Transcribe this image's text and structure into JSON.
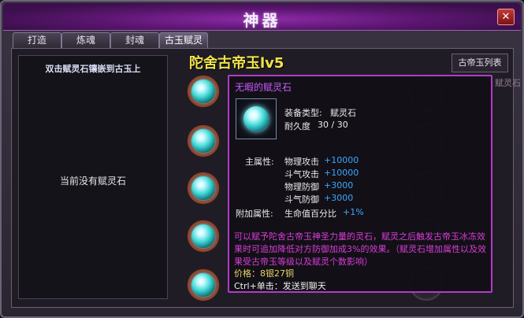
{
  "window": {
    "title": "神器",
    "close": "✕"
  },
  "tabs": [
    "打造",
    "炼魂",
    "封魂",
    "古玉赋灵"
  ],
  "left_panel": {
    "hint": "双击赋灵石镶嵌到古玉上",
    "empty": "当前没有赋灵石"
  },
  "jade": {
    "name": "陀舍古帝玉lv5",
    "list_button": "古帝玉列表"
  },
  "right_slot_label": "赋灵石",
  "tooltip": {
    "name": "无暇的赋灵石",
    "equip_type_label": "装备类型:",
    "equip_type": "赋灵石",
    "durability_label": "耐久度",
    "durability": "30 / 30",
    "main_attr_label": "主属性:",
    "attrs": [
      {
        "name": "物理攻击",
        "value": "+10000"
      },
      {
        "name": "斗气攻击",
        "value": "+10000"
      },
      {
        "name": "物理防御",
        "value": "+3000"
      },
      {
        "name": "斗气防御",
        "value": "+3000"
      }
    ],
    "extra_attr_label": "附加属性:",
    "extra_attr_name": "生命值百分比",
    "extra_attr_value": "+1%",
    "description": "可以赋予陀舍古帝玉神圣力量的灵石，赋灵之后触发古帝玉冰冻效果时可追加降低对方防御加成3%的效果。（赋灵石增加属性以及效果受古帝玉等级以及赋灵个数影响）",
    "price": "价格：8银27铜",
    "send": "Ctrl+单击：发送到聊天"
  }
}
